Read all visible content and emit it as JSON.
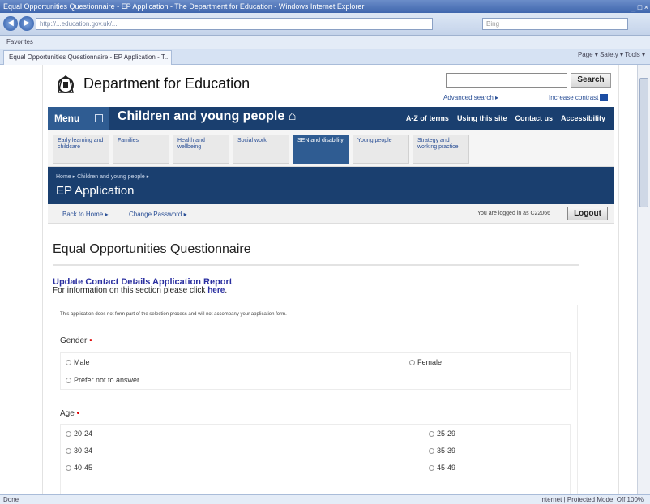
{
  "browser": {
    "title": "Equal Opportunities Questionnaire - EP Application - The Department for Education - Windows Internet Explorer",
    "controls": "_ □ ×",
    "back_icon": "back-arrow-icon",
    "forward_icon": "forward-arrow-icon",
    "url": "http://...education.gov.uk/...",
    "search_placeholder": "Bing",
    "favorites": "Favorites",
    "tab_title": "Equal Opportunities Questionnaire - EP Application - T...",
    "tools": "Page ▾  Safety ▾  Tools ▾",
    "status_left": "Done",
    "status_right": "Internet | Protected Mode: Off   100%"
  },
  "header": {
    "dept": "Department for Education",
    "search_button": "Search",
    "advanced": "Advanced search ▸",
    "contrast": "Increase contrast"
  },
  "nav": {
    "menu": "Menu",
    "section": "Children and young people",
    "links": [
      "A-Z of terms",
      "Using this site",
      "Contact us",
      "Accessibility"
    ]
  },
  "tabs": [
    {
      "label": "Early learning and childcare",
      "selected": false
    },
    {
      "label": "Families",
      "selected": false
    },
    {
      "label": "Health and wellbeing",
      "selected": false
    },
    {
      "label": "Social work",
      "selected": false
    },
    {
      "label": "SEN and disability",
      "selected": true
    },
    {
      "label": "Young people",
      "selected": false
    },
    {
      "label": "Strategy and working practice",
      "selected": false
    }
  ],
  "band": {
    "crumb": "Home ▸  Children and young people ▸",
    "title": "EP Application"
  },
  "subnav": {
    "home": "Back to Home ▸",
    "change_password": "Change Password ▸",
    "logged": "You are logged in as C22066",
    "logout": "Logout"
  },
  "content": {
    "title": "Equal Opportunities Questionnaire",
    "update": "Update Contact Details Application Report",
    "info": "For information on this section please click",
    "here": "here",
    "disclaimer": "This application does not form part of the selection process and will not accompany your application form.",
    "gender_label": "Gender",
    "gender_options": [
      "Male",
      "Female",
      "Prefer not to answer"
    ],
    "age_label": "Age",
    "age_options": [
      "20-24",
      "25-29",
      "30-34",
      "35-39",
      "40-45",
      "45-49"
    ]
  }
}
